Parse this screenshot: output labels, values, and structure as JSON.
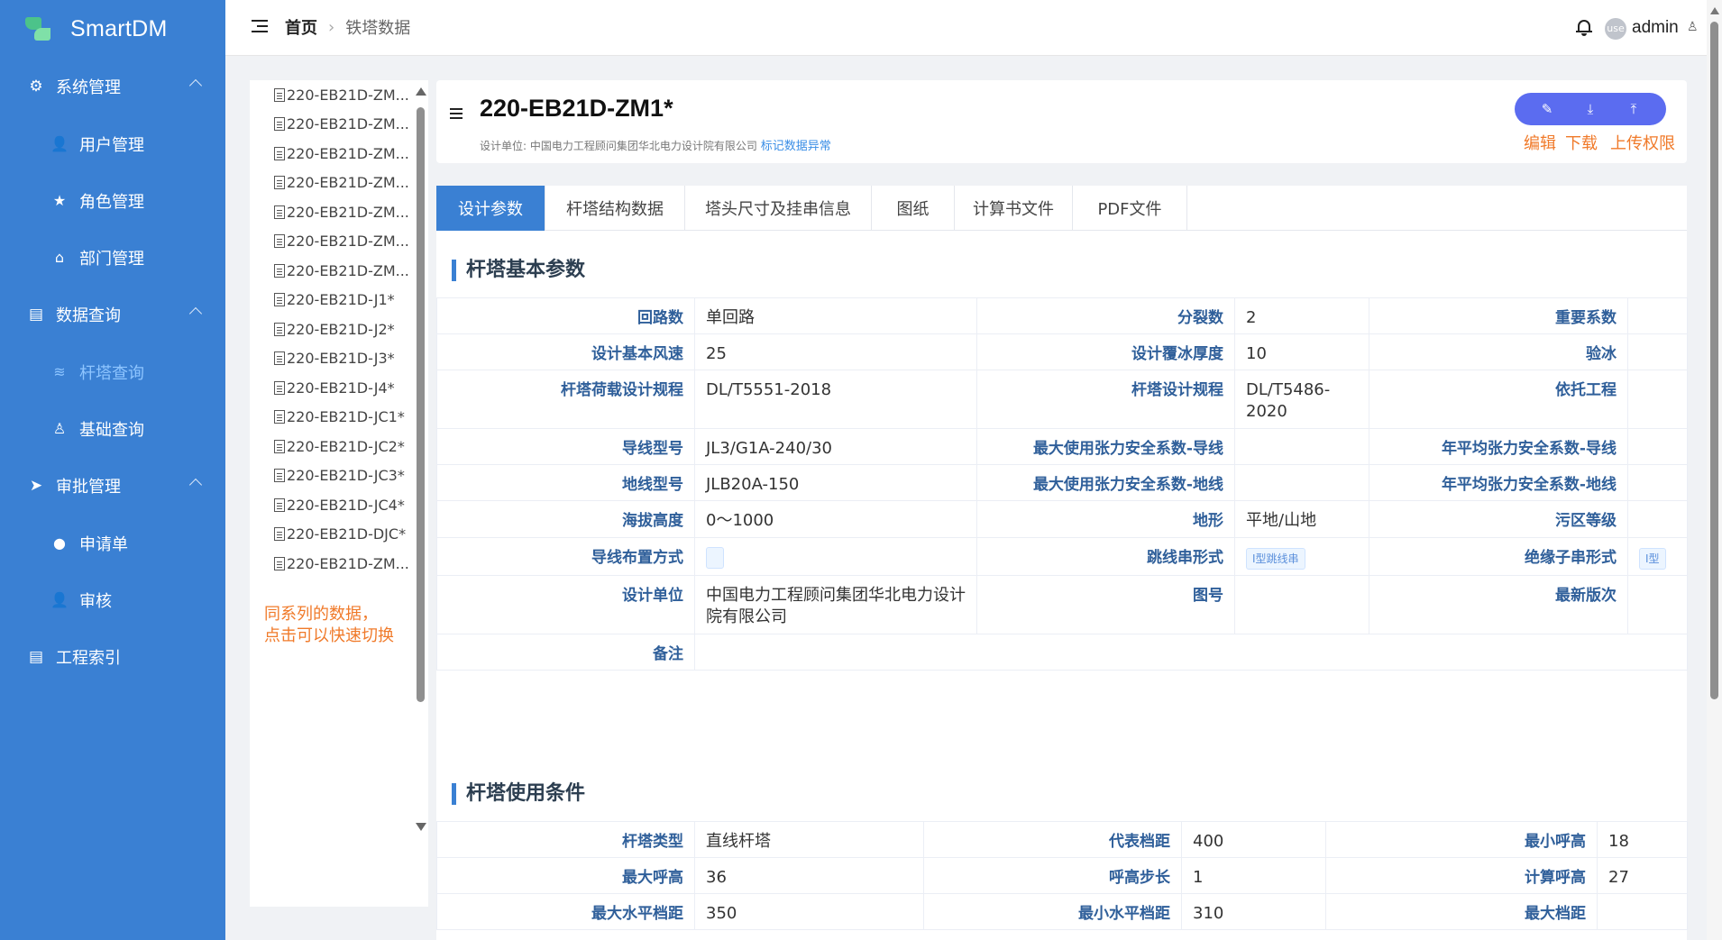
{
  "app": {
    "name": "SmartDM"
  },
  "sidebar": {
    "groups": [
      {
        "label": "系统管理",
        "icon": "gear-icon",
        "items": [
          {
            "label": "用户管理",
            "icon": "user-icon"
          },
          {
            "label": "角色管理",
            "icon": "star-icon"
          },
          {
            "label": "部门管理",
            "icon": "home-icon"
          }
        ]
      },
      {
        "label": "数据查询",
        "icon": "clipboard-icon",
        "items": [
          {
            "label": "杆塔查询",
            "icon": "database-icon",
            "active": true
          },
          {
            "label": "基础查询",
            "icon": "user-outline-icon"
          }
        ]
      },
      {
        "label": "审批管理",
        "icon": "send-icon",
        "items": [
          {
            "label": "申请单",
            "icon": "bulb-icon"
          },
          {
            "label": "审核",
            "icon": "user-check-icon"
          }
        ]
      },
      {
        "label": "工程索引",
        "icon": "clipboard-icon"
      }
    ]
  },
  "header": {
    "breadcrumb": {
      "home": "首页",
      "current": "铁塔数据"
    },
    "avatar_text": "use",
    "username": "admin"
  },
  "tree": {
    "items": [
      "220-EB21D-ZM...",
      "220-EB21D-ZM...",
      "220-EB21D-ZM...",
      "220-EB21D-ZM...",
      "220-EB21D-ZM...",
      "220-EB21D-ZM...",
      "220-EB21D-ZM...",
      "220-EB21D-J1*",
      "220-EB21D-J2*",
      "220-EB21D-J3*",
      "220-EB21D-J4*",
      "220-EB21D-JC1*",
      "220-EB21D-JC2*",
      "220-EB21D-JC3*",
      "220-EB21D-JC4*",
      "220-EB21D-DJC*",
      "220-EB21D-ZM..."
    ],
    "note_line1": "同系列的数据，",
    "note_line2": "点击可以快速切换"
  },
  "title_card": {
    "title": "220-EB21D-ZM1*",
    "design_unit_text": "设计单位: 中国电力工程顾问集团华北电力设计院有限公司",
    "flag_link": "标记数据异常",
    "actions": {
      "edit": "编辑",
      "download": "下载",
      "upload": "上传权限"
    }
  },
  "tabs": [
    "设计参数",
    "杆塔结构数据",
    "塔头尺寸及挂串信息",
    "图纸",
    "计算书文件",
    "PDF文件"
  ],
  "basic_params": {
    "section_title": "杆塔基本参数",
    "rows": [
      {
        "l1": "回路数",
        "v1": "单回路",
        "l2": "分裂数",
        "v2": "2",
        "l3": "重要系数",
        "v3": ""
      },
      {
        "l1": "设计基本风速",
        "v1": "25",
        "l2": "设计覆冰厚度",
        "v2": "10",
        "l3": "验冰",
        "v3": ""
      },
      {
        "l1": "杆塔荷载设计规程",
        "v1": "DL/T5551-2018",
        "l2": "杆塔设计规程",
        "v2": "DL/T5486-2020",
        "l3": "依托工程",
        "v3": ""
      },
      {
        "l1": "导线型号",
        "v1": "JL3/G1A-240/30",
        "l2": "最大使用张力安全系数-导线",
        "v2": "",
        "l3": "年平均张力安全系数-导线",
        "v3": ""
      },
      {
        "l1": "地线型号",
        "v1": "JLB20A-150",
        "l2": "最大使用张力安全系数-地线",
        "v2": "",
        "l3": "年平均张力安全系数-地线",
        "v3": ""
      },
      {
        "l1": "海拔高度",
        "v1": "0～1000",
        "l2": "地形",
        "v2": "平地/山地",
        "l3": "污区等级",
        "v3": ""
      },
      {
        "l1": "导线布置方式",
        "v1": "",
        "l2": "跳线串形式",
        "v2": "I型跳线串",
        "l3": "绝缘子串形式",
        "v3": "I型"
      },
      {
        "l1": "设计单位",
        "v1": "中国电力工程顾问集团华北电力设计院有限公司",
        "l2": "图号",
        "v2": "",
        "l3": "最新版次",
        "v3": ""
      }
    ],
    "remark_label": "备注",
    "remark_value": ""
  },
  "usage_conditions": {
    "section_title": "杆塔使用条件",
    "rows": [
      {
        "l1": "杆塔类型",
        "v1": "直线杆塔",
        "l2": "代表档距",
        "v2": "400",
        "l3": "最小呼高",
        "v3": "18"
      },
      {
        "l1": "最大呼高",
        "v1": "36",
        "l2": "呼高步长",
        "v2": "1",
        "l3": "计算呼高",
        "v3": "27"
      },
      {
        "l1": "最大水平档距",
        "v1": "350",
        "l2": "最小水平档距",
        "v2": "310",
        "l3": "最大档距",
        "v3": ""
      }
    ]
  }
}
